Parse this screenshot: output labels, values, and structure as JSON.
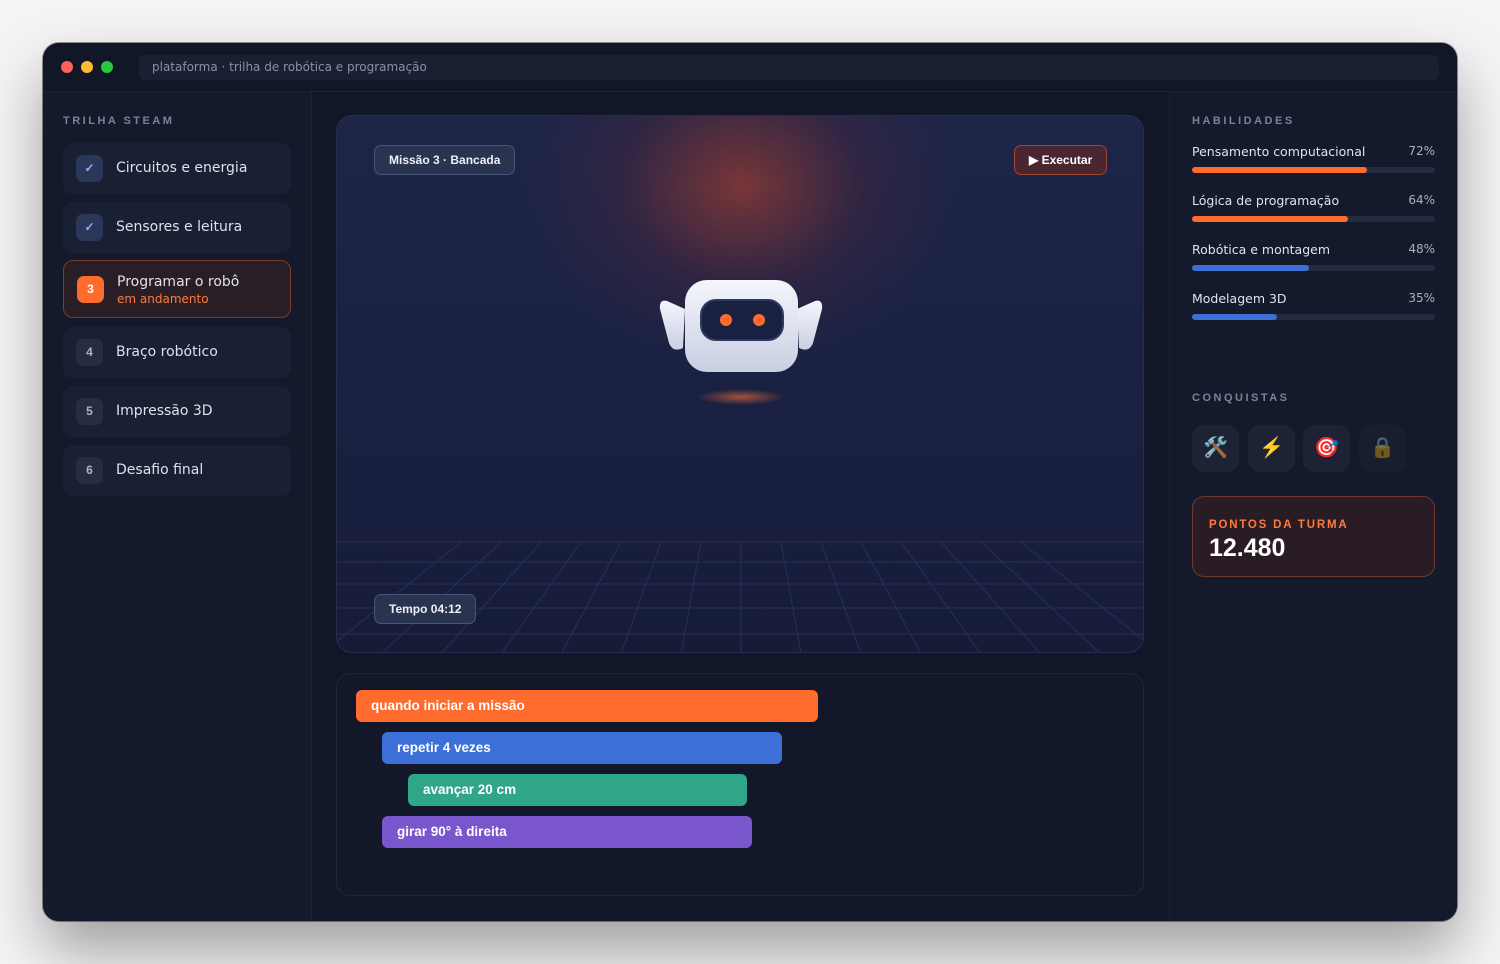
{
  "window": {
    "url": "plataforma · trilha de robótica e programação"
  },
  "sidebar": {
    "title": "TRILHA STEAM",
    "steps": [
      {
        "marker": "✓",
        "label": "Circuitos e energia",
        "status": "done"
      },
      {
        "marker": "✓",
        "label": "Sensores e leitura",
        "status": "done"
      },
      {
        "marker": "3",
        "label": "Programar o robô",
        "status": "active",
        "sub": "em andamento"
      },
      {
        "marker": "4",
        "label": "Braço robótico",
        "status": "locked"
      },
      {
        "marker": "5",
        "label": "Impressão 3D",
        "status": "locked"
      },
      {
        "marker": "6",
        "label": "Desafio final",
        "status": "locked"
      }
    ]
  },
  "stage": {
    "mission": "Missão 3 · Bancada",
    "run_label": "▶ Executar",
    "timer": "Tempo 04:12"
  },
  "code_blocks": [
    {
      "label": "quando iniciar a missão",
      "color": "#ff6b2c"
    },
    {
      "label": "repetir 4 vezes",
      "color": "#3d6fd8"
    },
    {
      "label": "avançar 20 cm",
      "color": "#2fa688"
    },
    {
      "label": "girar 90° à direita",
      "color": "#7a56cc"
    }
  ],
  "skills": {
    "title": "HABILIDADES",
    "items": [
      {
        "name": "Pensamento computacional",
        "pct_label": "72%",
        "value": 0.72,
        "color": "#ff6b2c"
      },
      {
        "name": "Lógica de programação",
        "pct_label": "64%",
        "value": 0.64,
        "color": "#ff6b2c"
      },
      {
        "name": "Robótica e montagem",
        "pct_label": "48%",
        "value": 0.48,
        "color": "#3d6fd8"
      },
      {
        "name": "Modelagem 3D",
        "pct_label": "35%",
        "value": 0.35,
        "color": "#3d6fd8"
      }
    ]
  },
  "achievements": {
    "title": "CONQUISTAS",
    "badges": [
      {
        "icon": "tools-icon",
        "glyph": "🛠️"
      },
      {
        "icon": "lightning-icon",
        "glyph": "⚡"
      },
      {
        "icon": "target-icon",
        "glyph": "🎯"
      },
      {
        "icon": "lock-icon",
        "glyph": "🔒"
      }
    ]
  },
  "points": {
    "label": "PONTOS DA TURMA",
    "value": "12.480"
  },
  "colors": {
    "accent": "#ff6b2c",
    "blue": "#3d6fd8",
    "background": "#111628"
  }
}
